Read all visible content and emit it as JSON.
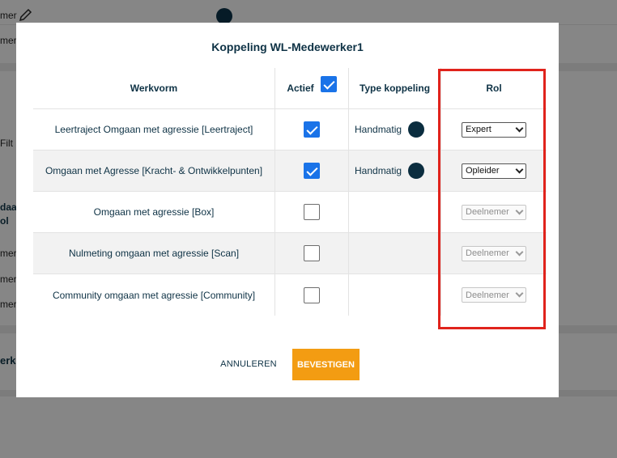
{
  "background": {
    "row_texts": [
      "mer",
      "mer",
      "mer",
      "mer",
      "mer"
    ],
    "filter_label": "Filt",
    "col_header_1": "daar",
    "col_header_2": "ol",
    "section_label": "erke"
  },
  "dialog": {
    "title": "Koppeling WL-Medewerker1",
    "columns": {
      "werkvorm": "Werkvorm",
      "actief": "Actief",
      "type": "Type koppeling",
      "rol": "Rol"
    },
    "header_checked": true,
    "rows": [
      {
        "werkvorm": "Leertraject Omgaan met agressie [Leertraject]",
        "actief": true,
        "type": "Handmatig",
        "rol": "Expert",
        "rol_enabled": true
      },
      {
        "werkvorm": "Omgaan met Agresse [Kracht- & Ontwikkelpunten]",
        "actief": true,
        "type": "Handmatig",
        "rol": "Opleider",
        "rol_enabled": true
      },
      {
        "werkvorm": "Omgaan met agressie [Box]",
        "actief": false,
        "type": "",
        "rol": "Deelnemer",
        "rol_enabled": false
      },
      {
        "werkvorm": "Nulmeting omgaan met agressie [Scan]",
        "actief": false,
        "type": "",
        "rol": "Deelnemer",
        "rol_enabled": false
      },
      {
        "werkvorm": "Community omgaan met agressie [Community]",
        "actief": false,
        "type": "",
        "rol": "Deelnemer",
        "rol_enabled": false
      }
    ],
    "cancel_label": "ANNULEREN",
    "confirm_label": "BEVESTIGEN"
  },
  "colors": {
    "accent": "#f39c12",
    "checkbox": "#1a73e8",
    "highlight": "#e0231c",
    "text": "#0e3245"
  }
}
